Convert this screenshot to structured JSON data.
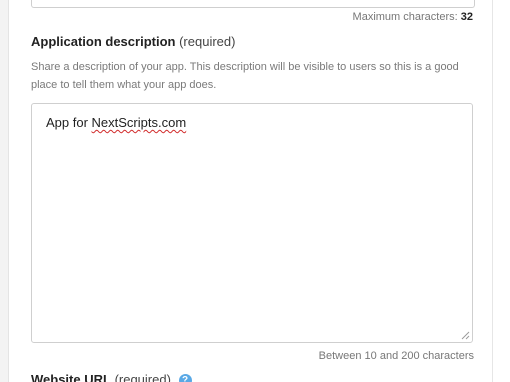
{
  "previous_field": {
    "max_chars_label": "Maximum characters:",
    "max_chars_value": "32"
  },
  "description_field": {
    "label": "Application description",
    "required_note": "(required)",
    "help_text": "Share a description of your app. This description will be visible to users so this is a good place to tell them what your app does.",
    "value_prefix": "App for ",
    "value_misspelled": "NextScripts.com",
    "length_hint": "Between 10 and 200 characters"
  },
  "website_field": {
    "label": "Website URL",
    "required_note": "(required)",
    "help_icon": "question-mark-icon",
    "help_icon_glyph": "?"
  },
  "colors": {
    "help_icon": "#5aa9e6",
    "spellcheck_underline": "#d12a2a"
  }
}
